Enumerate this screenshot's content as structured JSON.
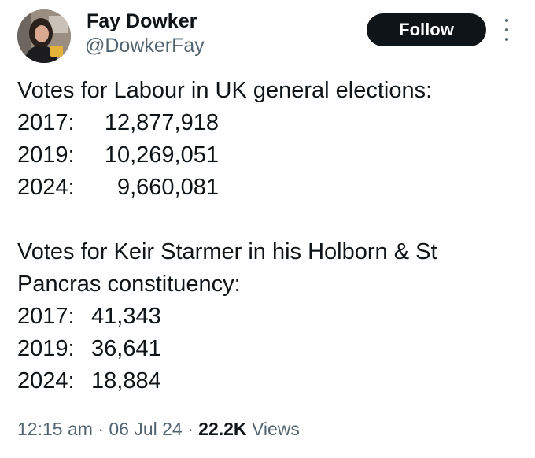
{
  "author": {
    "display_name": "Fay Dowker",
    "handle": "@DowkerFay"
  },
  "follow_label": "Follow",
  "tweet": {
    "intro_labour": "Votes for Labour in UK general elections:",
    "labour_votes": [
      {
        "year": "2017:",
        "votes": "12,877,918"
      },
      {
        "year": "2019:",
        "votes": "10,269,051"
      },
      {
        "year": "2024:",
        "votes": "9,660,081"
      }
    ],
    "intro_starmer_1": "Votes for Keir Starmer in his Holborn & St",
    "intro_starmer_2": "Pancras constituency:",
    "starmer_votes": [
      {
        "year": "2017:",
        "votes": "41,343"
      },
      {
        "year": "2019:",
        "votes": "36,641"
      },
      {
        "year": "2024:",
        "votes": "18,884"
      }
    ]
  },
  "meta": {
    "time": "12:15 am",
    "separator": "·",
    "date": "06 Jul 24",
    "views_count": "22.2K",
    "views_label": "Views"
  },
  "colors": {
    "text_primary": "#0f1419",
    "text_secondary": "#536471",
    "follow_bg": "#0f1419",
    "follow_text": "#ffffff"
  },
  "icons": {
    "more": "more-dots-icon"
  }
}
